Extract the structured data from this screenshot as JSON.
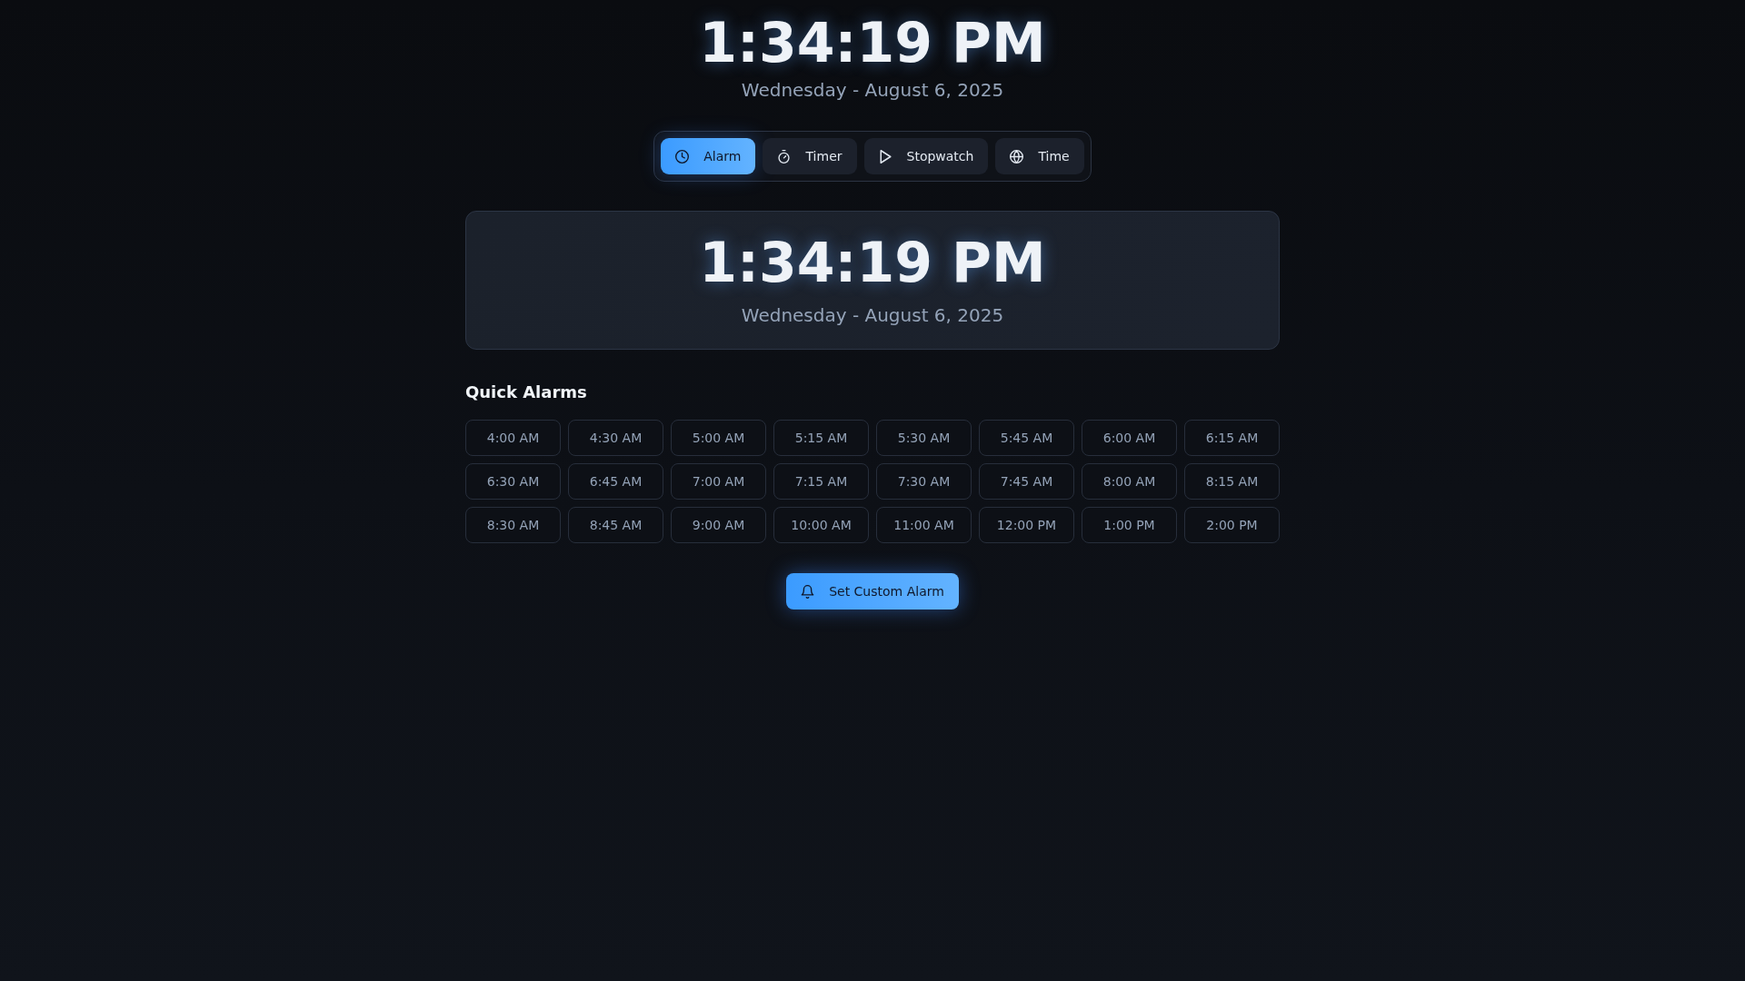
{
  "header": {
    "time": "1:34:19 PM",
    "date": "Wednesday - August 6, 2025"
  },
  "tabs": [
    {
      "label": "Alarm",
      "selected": true
    },
    {
      "label": "Timer",
      "selected": false
    },
    {
      "label": "Stopwatch",
      "selected": false
    },
    {
      "label": "Time",
      "selected": false
    }
  ],
  "clock_card": {
    "time": "1:34:19 PM",
    "date": "Wednesday - August 6, 2025"
  },
  "quick_alarms": {
    "title": "Quick Alarms",
    "times": [
      "4:00 AM",
      "4:30 AM",
      "5:00 AM",
      "5:15 AM",
      "5:30 AM",
      "5:45 AM",
      "6:00 AM",
      "6:15 AM",
      "6:30 AM",
      "6:45 AM",
      "7:00 AM",
      "7:15 AM",
      "7:30 AM",
      "7:45 AM",
      "8:00 AM",
      "8:15 AM",
      "8:30 AM",
      "8:45 AM",
      "9:00 AM",
      "10:00 AM",
      "11:00 AM",
      "12:00 PM",
      "1:00 PM",
      "2:00 PM"
    ]
  },
  "custom_alarm_button": {
    "label": "Set Custom Alarm"
  }
}
